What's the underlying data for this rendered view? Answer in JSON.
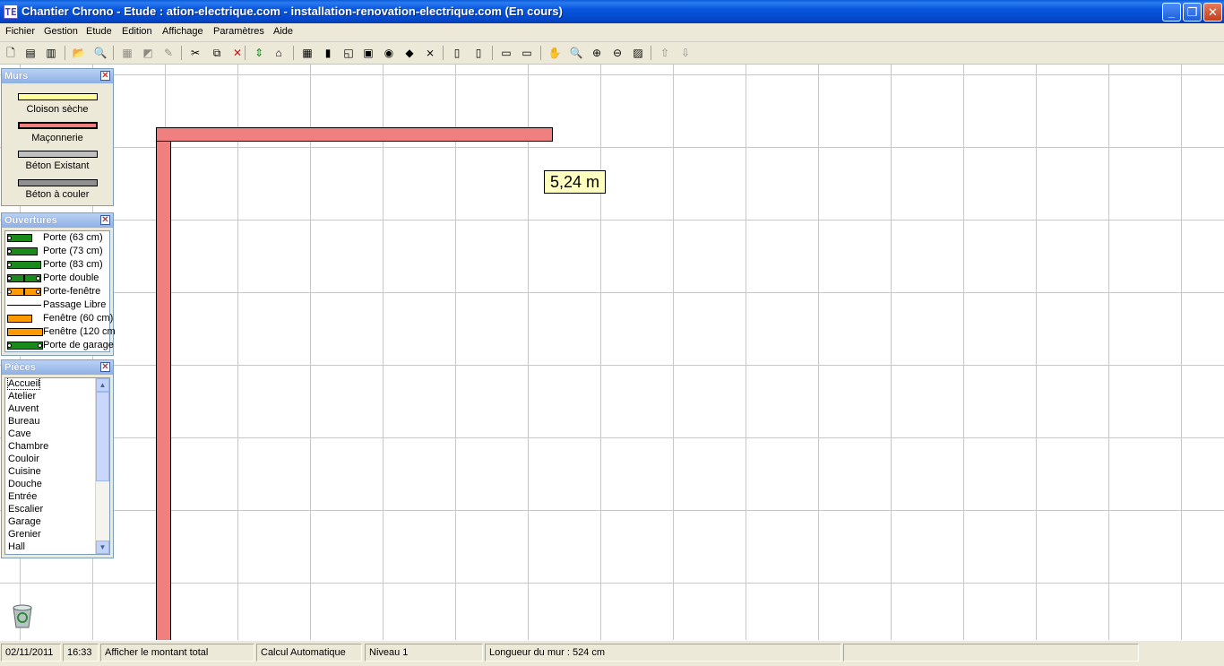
{
  "window": {
    "title": "Chantier Chrono - Etude : ation-electrique.com - installation-renovation-electrique.com (En cours)",
    "icon_text": "TE",
    "controls": {
      "minimize": "_",
      "maximize": "❐",
      "close": "✕"
    }
  },
  "menu": {
    "items": [
      "Fichier",
      "Gestion",
      "Etude",
      "Edition",
      "Affichage",
      "Paramètres",
      "Aide"
    ]
  },
  "toolbar": {
    "icons": [
      "new-document-icon",
      "list-icon",
      "bricks-icon",
      "open-folder-icon",
      "print-preview-icon",
      "table-icon",
      "chart-icon",
      "edit-icon",
      "cut-icon",
      "copy-icon",
      "delete-icon",
      "move-vertical-icon",
      "furniture-icon",
      "wall-grid-icon",
      "door-icon",
      "room-icon",
      "area-icon",
      "circle-icon",
      "diamond-icon",
      "cross-icon",
      "export-icon",
      "import-icon",
      "measure-icon",
      "measure2-icon",
      "hand-icon",
      "search-icon",
      "zoom-in-icon",
      "zoom-out-icon",
      "zoom-fit-icon",
      "arrow-up-icon",
      "arrow-down-icon"
    ],
    "glyphs": [
      "🗋",
      "▤",
      "▥",
      "📂",
      "🔍",
      "▦",
      "◩",
      "✎",
      "✂",
      "⧉",
      "✕",
      "⇕",
      "⌂",
      "▦",
      "▮",
      "◱",
      "▣",
      "◉",
      "◆",
      "⨯",
      "▯",
      "▯",
      "▭",
      "▭",
      "✋",
      "🔍",
      "⊕",
      "⊖",
      "▨",
      "⇧",
      "⇩"
    ]
  },
  "panels": {
    "murs": {
      "title": "Murs",
      "items": [
        {
          "label": "Cloison sèche",
          "color": "#ffff99"
        },
        {
          "label": "Maçonnerie",
          "color": "#f08080"
        },
        {
          "label": "Béton Existant",
          "color": "#c0c0c0"
        },
        {
          "label": "Béton à couler",
          "color": "#909090"
        }
      ]
    },
    "ouvertures": {
      "title": "Ouvertures",
      "items": [
        {
          "label": "Porte (63 cm)"
        },
        {
          "label": "Porte (73 cm)"
        },
        {
          "label": "Porte (83 cm)"
        },
        {
          "label": "Porte double"
        },
        {
          "label": "Porte-fenêtre"
        },
        {
          "label": "Passage Libre"
        },
        {
          "label": "Fenêtre (60 cm)"
        },
        {
          "label": "Fenêtre (120 cm"
        },
        {
          "label": "Porte de garage"
        }
      ]
    },
    "pieces": {
      "title": "Pièces",
      "items": [
        "Accueil",
        "Atelier",
        "Auvent",
        "Bureau",
        "Cave",
        "Chambre",
        "Couloir",
        "Cuisine",
        "Douche",
        "Entrée",
        "Escalier",
        "Garage",
        "Grenier",
        "Hall"
      ],
      "selected": "Accueil"
    }
  },
  "canvas": {
    "measurement": "5,24 m",
    "wall_color": "#f08080"
  },
  "status": {
    "date": "02/11/2011",
    "time": "16:33",
    "total": "Afficher le montant total",
    "calc": "Calcul Automatique",
    "level": "Niveau 1",
    "wall_length": "Longueur du mur : 524 cm",
    "empty": ""
  }
}
